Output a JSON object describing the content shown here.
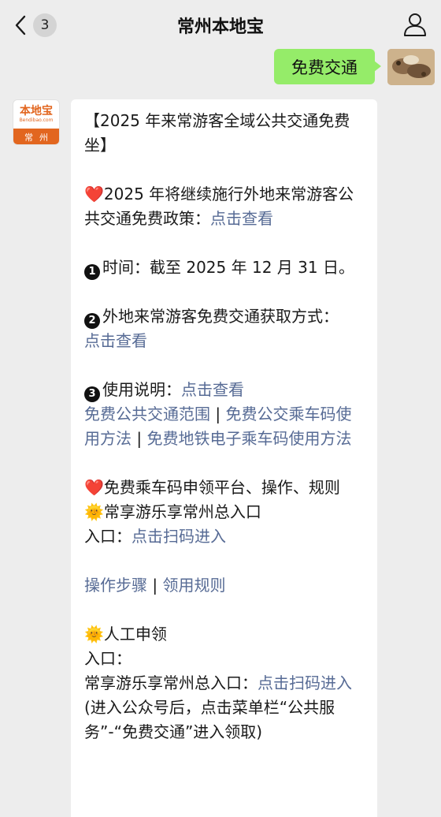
{
  "header": {
    "title": "常州本地宝",
    "back_count": "3"
  },
  "outgoing": {
    "text": "免费交通"
  },
  "bot": {
    "logo_main": "本地宝",
    "logo_sub": "Bendibao.com",
    "logo_city": "常州"
  },
  "article": {
    "title": "【2025 年来常游客全域公共交通免费坐】",
    "heart_icon": "❤️",
    "sun_icon": "🌞",
    "policy_text": "2025 年将继续施行外地来常游客公共交通免费政策：",
    "policy_link": "点击查看",
    "n1": "1",
    "time_text": "时间：截至 2025 年 12 月 31 日。",
    "n2": "2",
    "method_text": "外地来常游客免费交通获取方式：",
    "method_link": "点击查看",
    "n3": "3",
    "usage_text": "使用说明：",
    "usage_link": "点击查看",
    "usage_sub_links": [
      "免费公共交通范围",
      "免费公交乘车码使用方法",
      "免费地铁电子乘车码使用方法"
    ],
    "separator": " | ",
    "platform_heading": "免费乘车码申领平台、操作、规则",
    "entry_title": "常享游乐享常州总入口",
    "entry_label": "入口：",
    "entry_link": "点击扫码进入",
    "steps_link": "操作步骤",
    "rules_link": "领用规则",
    "manual_title": "人工申领",
    "manual_entry_label": "入口：",
    "manual_entry_text": "常享游乐享常州总入口：",
    "manual_entry_link": "点击扫码进入",
    "manual_note": "(进入公众号后，点击菜单栏“公共服务”-“免费交通”进入领取)"
  },
  "colors": {
    "link": "#576b95",
    "bubble_out": "#95ec69",
    "background": "#ededed",
    "logo": "#e2661f"
  }
}
